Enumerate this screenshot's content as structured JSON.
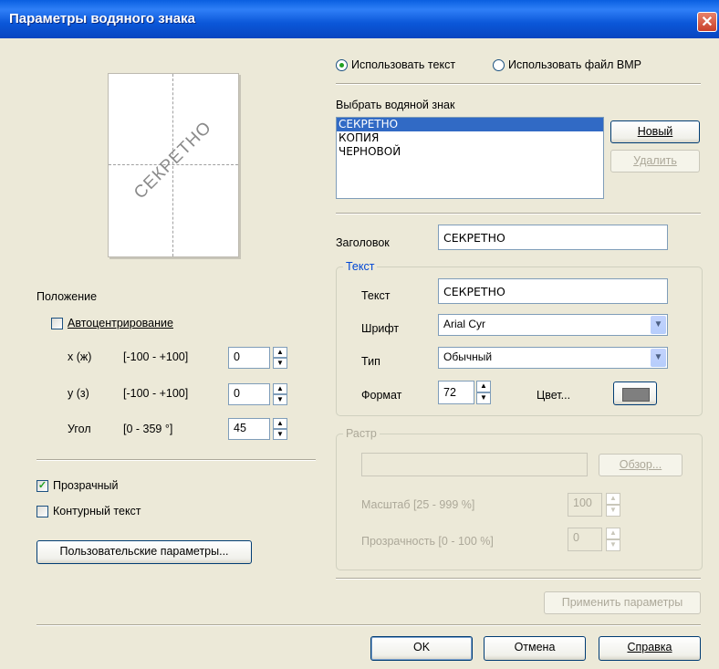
{
  "window": {
    "title": "Параметры водяного знака",
    "close_label": "✕"
  },
  "preview": {
    "watermark_text": "СЕКРЕТНО"
  },
  "position": {
    "heading": "Положение",
    "autocenter_label": "Автоцентрирование",
    "autocenter_checked": false,
    "x": {
      "label": "x (ж)",
      "range": "[-100 - +100]",
      "value": "0"
    },
    "y": {
      "label": "y (з)",
      "range": "[-100 - +100]",
      "value": "0"
    },
    "angle": {
      "label": "Угол",
      "range": "[0 - 359 °]",
      "value": "45"
    }
  },
  "transparent": {
    "label": "Прозрачный",
    "checked": true
  },
  "outline": {
    "label": "Контурный текст",
    "checked": false
  },
  "custom_settings_button": "Пользовательские параметры...",
  "source": {
    "use_text_label": "Использовать текст",
    "use_bmp_label": "Использовать файл BMP",
    "selected": "text"
  },
  "watermark_list": {
    "label": "Выбрать водяной знак",
    "items": [
      "СЕКРЕТНО",
      "КОПИЯ",
      "ЧЕРНОВОЙ"
    ],
    "selected_index": 0,
    "new_button": "Новый",
    "delete_button": "Удалить"
  },
  "caption": {
    "label": "Заголовок",
    "value": "СЕКРЕТНО"
  },
  "text_group": {
    "title": "Текст",
    "text_label": "Текст",
    "text_value": "СЕКРЕТНО",
    "font_label": "Шрифт",
    "font_value": "Arial Cyr",
    "style_label": "Тип",
    "style_value": "Обычный",
    "size_label": "Формат",
    "size_value": "72",
    "color_label": "Цвет...",
    "color_swatch": "#7f7f7f"
  },
  "raster_group": {
    "title": "Растр",
    "path_value": "",
    "browse_button": "Обзор...",
    "scale_label": "Масштаб [25 - 999 %]",
    "scale_value": "100",
    "transparency_label": "Прозрачность [0 - 100 %]",
    "transparency_value": "0"
  },
  "apply_button": "Применить параметры",
  "ok_button": "OK",
  "cancel_button": "Отмена",
  "help_button": "Справка"
}
